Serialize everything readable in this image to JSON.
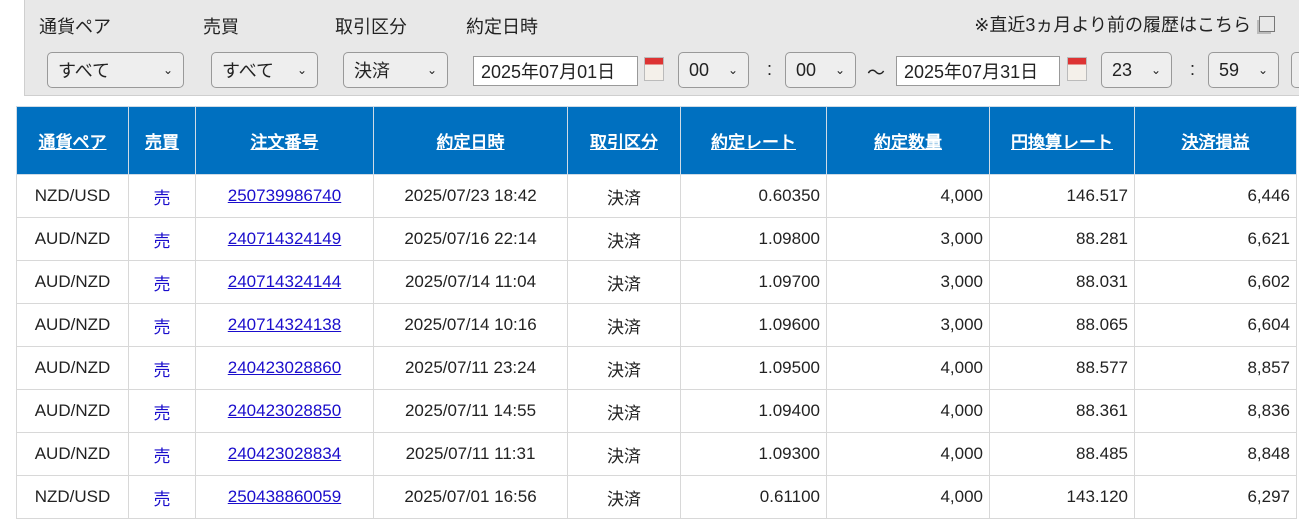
{
  "filters": {
    "labels": [
      "通貨ペア",
      "売買",
      "取引区分",
      "約定日時"
    ],
    "currency_pair": "すべて",
    "side": "すべて",
    "trade_type": "決済",
    "date_from": "2025年07月01日",
    "hour_from": "00",
    "minute_from": "00",
    "tilde": "～",
    "date_to": "2025年07月31日",
    "hour_to": "23",
    "minute_to": "59",
    "colon": ":",
    "history_link": "※直近3ヵ月より前の履歴はこちら"
  },
  "table": {
    "headers": [
      "通貨ペア",
      "売買",
      "注文番号",
      "約定日時",
      "取引区分",
      "約定レート",
      "約定数量",
      "円換算レート",
      "決済損益"
    ],
    "rows": [
      [
        "NZD/USD",
        "売",
        "250739986740",
        "2025/07/23 18:42",
        "決済",
        "0.60350",
        "4,000",
        "146.517",
        "6,446"
      ],
      [
        "AUD/NZD",
        "売",
        "240714324149",
        "2025/07/16 22:14",
        "決済",
        "1.09800",
        "3,000",
        "88.281",
        "6,621"
      ],
      [
        "AUD/NZD",
        "売",
        "240714324144",
        "2025/07/14 11:04",
        "決済",
        "1.09700",
        "3,000",
        "88.031",
        "6,602"
      ],
      [
        "AUD/NZD",
        "売",
        "240714324138",
        "2025/07/14 10:16",
        "決済",
        "1.09600",
        "3,000",
        "88.065",
        "6,604"
      ],
      [
        "AUD/NZD",
        "売",
        "240423028860",
        "2025/07/11 23:24",
        "決済",
        "1.09500",
        "4,000",
        "88.577",
        "8,857"
      ],
      [
        "AUD/NZD",
        "売",
        "240423028850",
        "2025/07/11 14:55",
        "決済",
        "1.09400",
        "4,000",
        "88.361",
        "8,836"
      ],
      [
        "AUD/NZD",
        "売",
        "240423028834",
        "2025/07/11 11:31",
        "決済",
        "1.09300",
        "4,000",
        "88.485",
        "8,848"
      ],
      [
        "NZD/USD",
        "売",
        "250438860059",
        "2025/07/01 16:56",
        "決済",
        "0.61100",
        "4,000",
        "143.120",
        "6,297"
      ]
    ]
  },
  "colors": {
    "header_bg": "#0070c0",
    "link": "#1a0dcc"
  }
}
